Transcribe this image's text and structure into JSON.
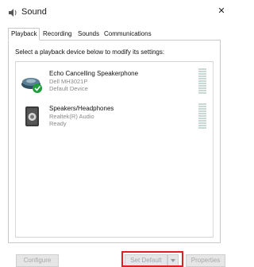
{
  "window": {
    "title": "Sound",
    "close_glyph": "✕"
  },
  "tabs": [
    {
      "label": "Playback",
      "active": true
    },
    {
      "label": "Recording",
      "active": false
    },
    {
      "label": "Sounds",
      "active": false
    },
    {
      "label": "Communications",
      "active": false
    }
  ],
  "panel": {
    "instruction": "Select a playback device below to modify its settings:"
  },
  "devices": [
    {
      "name": "Echo Cancelling Speakerphone",
      "model": "Dell MH3021P",
      "status": "Default Device",
      "icon": "speakerphone-icon",
      "badge": "default-check-icon"
    },
    {
      "name": "Speakers/Headphones",
      "model": "Realtek(R) Audio",
      "status": "Ready",
      "icon": "speaker-icon"
    }
  ],
  "buttons": {
    "configure": "Configure",
    "set_default": "Set Default",
    "properties": "Properties"
  },
  "colors": {
    "highlight": "#e02020",
    "default_check": "#1f9d3a",
    "disabled_text": "#a8a8a8"
  }
}
